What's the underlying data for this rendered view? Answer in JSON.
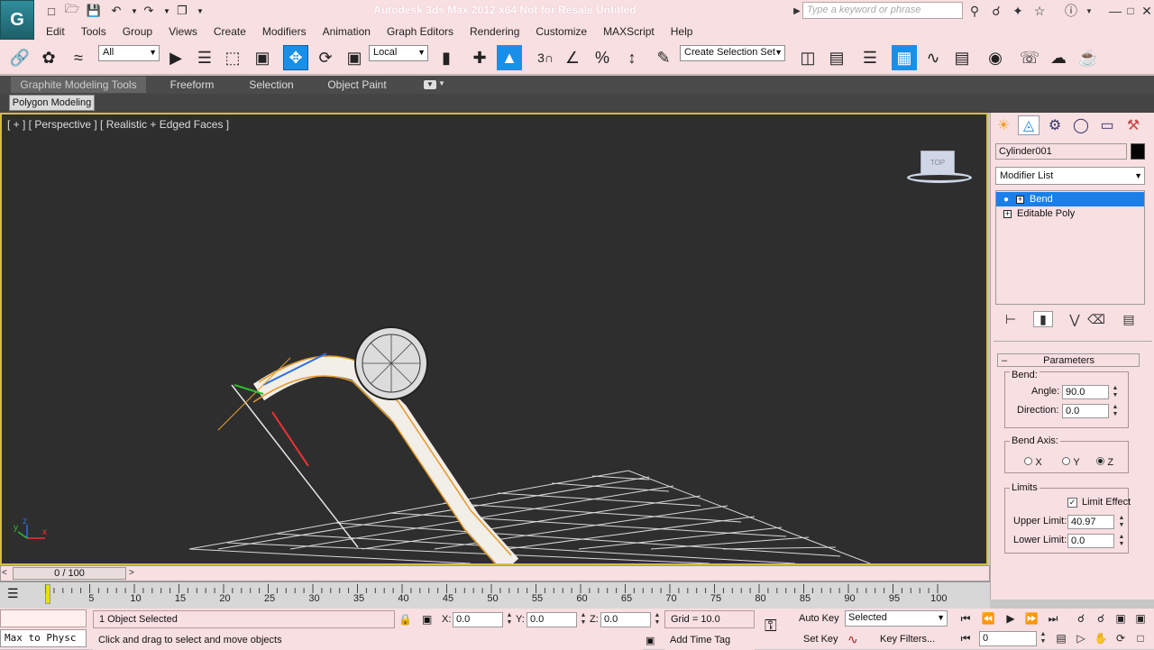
{
  "titlebar": {
    "app_logo": "G",
    "title": "Autodesk 3ds Max  2012 x64    Not for Resale    Untitled",
    "search_placeholder": "Type a keyword or phrase"
  },
  "menu": [
    "Edit",
    "Tools",
    "Group",
    "Views",
    "Create",
    "Modifiers",
    "Animation",
    "Graph Editors",
    "Rendering",
    "Customize",
    "MAXScript",
    "Help"
  ],
  "toolbar": {
    "selection_filter": "All",
    "reference_coord": "Local",
    "named_selection": "Create Selection Set",
    "snap_label": "3"
  },
  "ribbon": {
    "tabs": [
      "Graphite Modeling Tools",
      "Freeform",
      "Selection",
      "Object Paint"
    ],
    "panel": "Polygon Modeling"
  },
  "viewport": {
    "label": "[ + ] [ Perspective ] [ Realistic + Edged Faces ]",
    "viewcube_label": "TOP",
    "axis_labels": {
      "x": "x",
      "y": "y",
      "z": "z"
    }
  },
  "command_panel": {
    "object_name": "Cylinder001",
    "modifier_list_label": "Modifier List",
    "stack": [
      {
        "label": "Bend",
        "selected": true
      },
      {
        "label": "Editable Poly",
        "selected": false
      }
    ],
    "rollout_title": "Parameters",
    "bend_group": "Bend:",
    "angle_label": "Angle:",
    "angle_value": "90.0",
    "direction_label": "Direction:",
    "direction_value": "0.0",
    "bend_axis_group": "Bend Axis:",
    "axis_x": "X",
    "axis_y": "Y",
    "axis_z": "Z",
    "selected_axis": "Z",
    "limits_group": "Limits",
    "limit_effect_label": "Limit Effect",
    "limit_effect_checked": true,
    "upper_limit_label": "Upper Limit:",
    "upper_limit_value": "40.97",
    "lower_limit_label": "Lower Limit:",
    "lower_limit_value": "0.0"
  },
  "timeline": {
    "frame_display": "0 / 100",
    "ticks": [
      "5",
      "10",
      "15",
      "20",
      "25",
      "30",
      "35",
      "40",
      "45",
      "50",
      "55",
      "60",
      "65",
      "70",
      "75",
      "80",
      "85",
      "90",
      "95",
      "100"
    ]
  },
  "status": {
    "maxscript_text": "Max to Physc",
    "selection_info": "1 Object Selected",
    "prompt": "Click and drag to select and move objects",
    "x_label": "X:",
    "x_value": "0.0",
    "y_label": "Y:",
    "y_value": "0.0",
    "z_label": "Z:",
    "z_value": "0.0",
    "grid": "Grid = 10.0",
    "add_time_tag": "Add Time Tag",
    "auto_key": "Auto Key",
    "set_key": "Set Key",
    "key_mode_value": "Selected",
    "key_filters": "Key Filters...",
    "current_frame": "0"
  }
}
